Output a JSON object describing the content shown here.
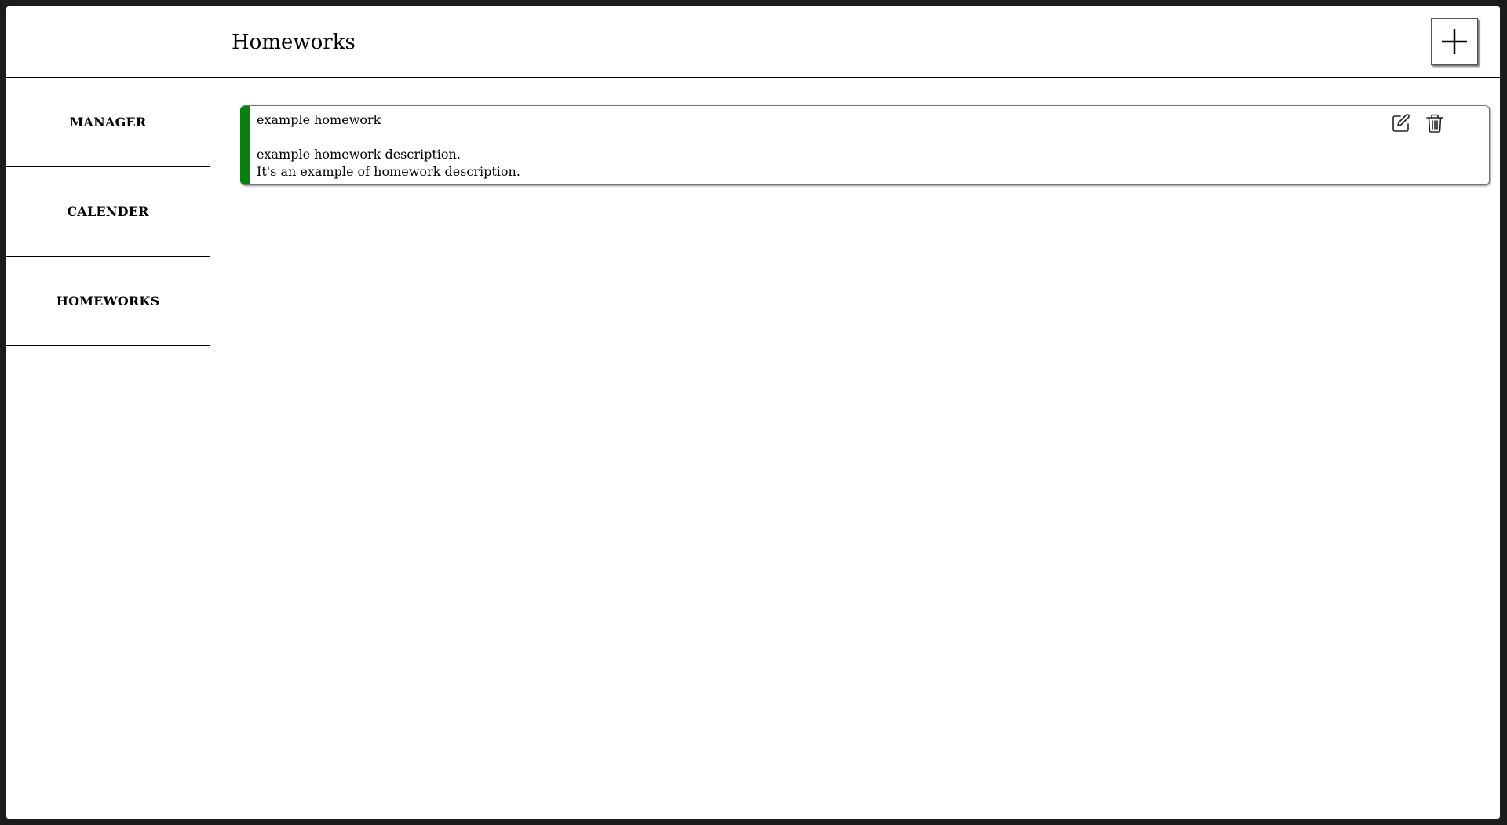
{
  "sidebar": {
    "items": [
      {
        "label": "MANAGER"
      },
      {
        "label": "CALENDER"
      },
      {
        "label": "HOMEWORKS"
      }
    ]
  },
  "header": {
    "title": "Homeworks",
    "add_icon": "plus-icon"
  },
  "homeworks": [
    {
      "title": "example homework",
      "description_lines": [
        "example homework description.",
        "It's an example of homework description."
      ],
      "status_color": "#0a7f0f",
      "edit_icon": "edit-icon",
      "delete_icon": "trash-icon"
    }
  ]
}
